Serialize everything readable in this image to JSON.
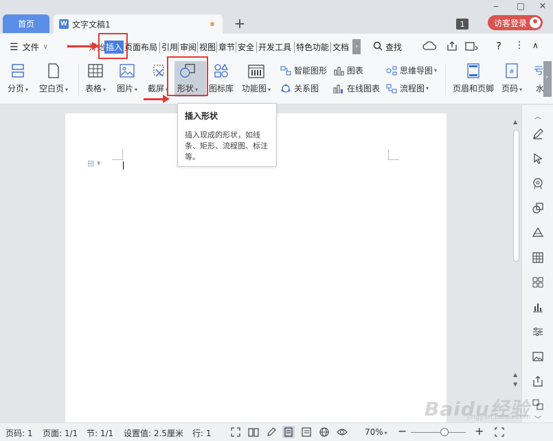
{
  "titlebar": {
    "home_tab": "首页",
    "doc_tab": "文字文稿1",
    "doc_icon": "W",
    "add_tab": "+",
    "notification_count": "1",
    "login_button": "访客登录",
    "window_controls": [
      "⎯",
      "▢",
      "✕"
    ]
  },
  "menubar": {
    "file": "文件",
    "tabs": [
      "开始",
      "插入",
      "页面布局",
      "引用",
      "审阅",
      "视图",
      "章节",
      "安全",
      "开发工具",
      "特色功能",
      "文档"
    ],
    "active_tab": "插入",
    "search": "查找"
  },
  "ribbon": {
    "pagebreak": "分页",
    "blankpage": "空白页",
    "table": "表格",
    "picture": "图片",
    "screenshot": "截屏",
    "shape": "形状",
    "iconlib": "图标库",
    "funcchart": "功能图",
    "smartart": "智能图形",
    "chart": "图表",
    "mindmap": "思维导图",
    "relation": "关系图",
    "onlinechart": "在线图表",
    "flowchart": "流程图",
    "headerfooter": "页眉和页脚",
    "pagenum": "页码",
    "watermark": "水"
  },
  "tooltip": {
    "title": "插入形状",
    "body": "插入现成的形状，如线条、矩形、流程图、标注等。"
  },
  "statusbar": {
    "page": "页码: 1",
    "pages": "页面: 1/1",
    "section": "节: 1/1",
    "setting": "设置值: 2.5厘米",
    "line": "行: 1",
    "zoom": "70%",
    "zoom_minus": "−",
    "zoom_plus": "+"
  },
  "watermark": {
    "brand": "Baidu经验",
    "url": "jingyan.baidu.com"
  },
  "colors": {
    "accent": "#4a7ee0",
    "annotation": "#e53935",
    "login": "#d9534f"
  }
}
